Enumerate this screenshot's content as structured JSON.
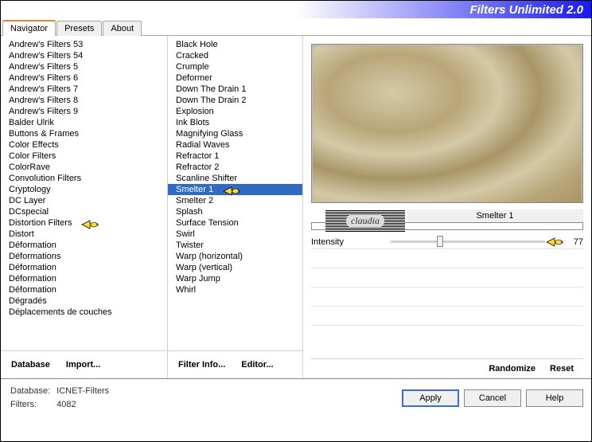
{
  "title": "Filters Unlimited 2.0",
  "tabs": {
    "navigator": "Navigator",
    "presets": "Presets",
    "about": "About"
  },
  "categories": [
    "Andrew's Filters 53",
    "Andrew's Filters 54",
    "Andrew's Filters 5",
    "Andrew's Filters 6",
    "Andrew's Filters 7",
    "Andrew's Filters 8",
    "Andrew's Filters 9",
    "Balder Ulrik",
    "Buttons & Frames",
    "Color Effects",
    "Color Filters",
    "ColorRave",
    "Convolution Filters",
    "Cryptology",
    "DC Layer",
    "DCspecial",
    "Distortion Filters",
    "Distort",
    "Déformation",
    "Déformations",
    "Déformation",
    "Déformation",
    "Déformation",
    "Dégradés",
    "Déplacements de couches"
  ],
  "categories_highlight_index": 16,
  "filters": [
    "Black Hole",
    "Cracked",
    "Crumple",
    "Deformer",
    "Down The Drain 1",
    "Down The Drain 2",
    "Explosion",
    "Ink Blots",
    "Magnifying Glass",
    "Radial Waves",
    "Refractor 1",
    "Refractor 2",
    "Scanline Shifter",
    "Smelter 1",
    "Smelter 2",
    "Splash",
    "Surface Tension",
    "Swirl",
    "Twister",
    "Warp (horizontal)",
    "Warp (vertical)",
    "Warp Jump",
    "Whirl"
  ],
  "filters_selected_index": 13,
  "selected_filter_name": "Smelter 1",
  "params": [
    {
      "name": "Intensity",
      "value": 77,
      "thumb_pct": 30
    }
  ],
  "toolbar": {
    "database": "Database",
    "import": "Import...",
    "filterinfo": "Filter Info...",
    "editor": "Editor...",
    "randomize": "Randomize",
    "reset": "Reset"
  },
  "footer": {
    "db_label": "Database:",
    "db_value": "ICNET-Filters",
    "filters_label": "Filters:",
    "filters_value": "4082"
  },
  "buttons": {
    "apply": "Apply",
    "cancel": "Cancel",
    "help": "Help"
  },
  "watermark": "claudia"
}
